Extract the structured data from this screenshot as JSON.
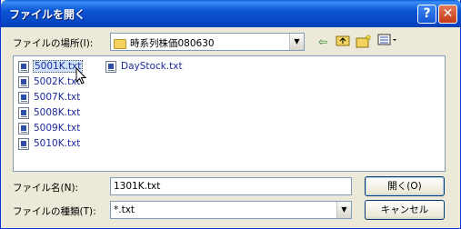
{
  "window": {
    "title": "ファイルを開く",
    "help_glyph": "?",
    "close_glyph": "✕"
  },
  "look_in": {
    "label": "ファイルの場所(I):",
    "value": "時系列株価080630"
  },
  "toolbar": [
    "back-icon",
    "up-folder-icon",
    "new-folder-icon",
    "view-menu-icon"
  ],
  "files": [
    {
      "name": "5001K.txt",
      "selected": true
    },
    {
      "name": "5002K.txt",
      "selected": false
    },
    {
      "name": "5007K.txt",
      "selected": false
    },
    {
      "name": "5008K.txt",
      "selected": false
    },
    {
      "name": "5009K.txt",
      "selected": false
    },
    {
      "name": "5010K.txt",
      "selected": false
    },
    {
      "name": "DayStock.txt",
      "selected": false
    }
  ],
  "filename": {
    "label": "ファイル名(N):",
    "value": "1301K.txt"
  },
  "filetype": {
    "label": "ファイルの種類(T):",
    "value": "*.txt"
  },
  "buttons": {
    "open": "開く(O)",
    "cancel": "キャンセル"
  }
}
